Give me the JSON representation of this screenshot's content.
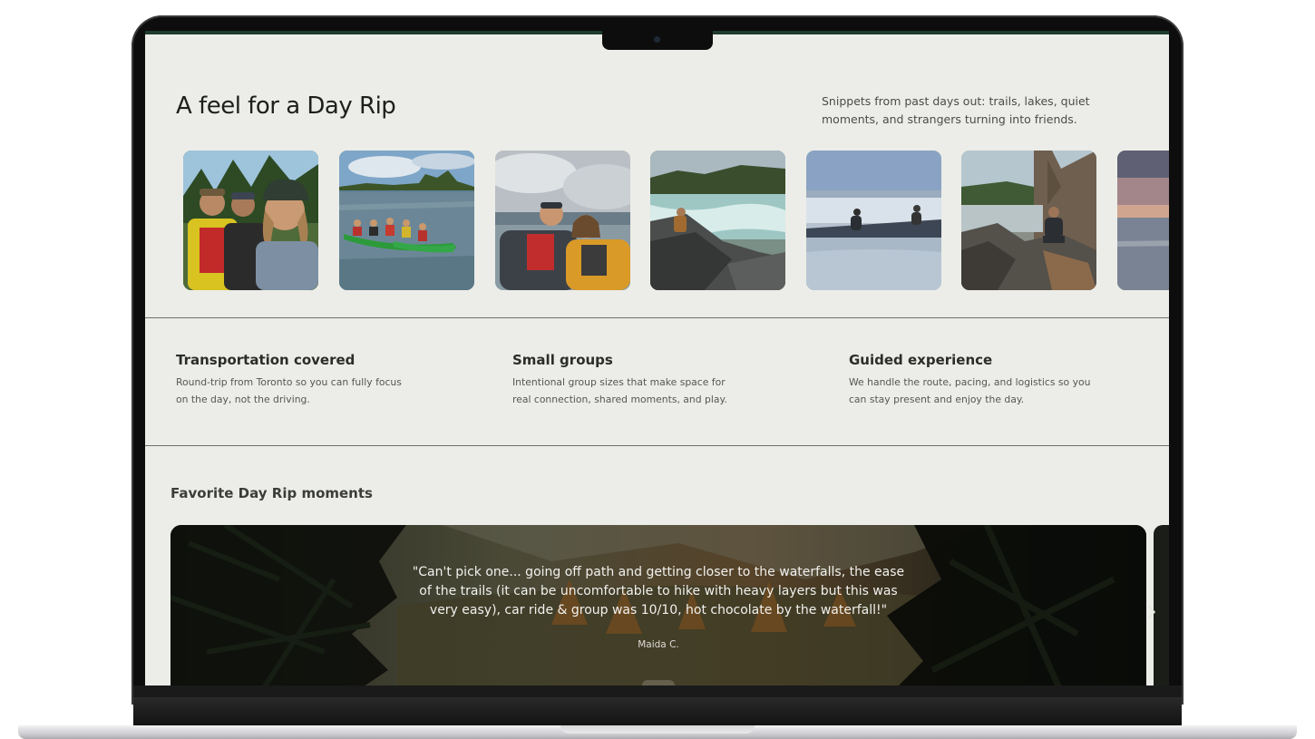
{
  "hero": {
    "title": "A feel for a Day Rip",
    "intro": "Snippets from past days out: trails, lakes, quiet moments, and strangers turning into friends."
  },
  "gallery": {
    "photos": [
      {
        "icon": "group-selfie-photo"
      },
      {
        "icon": "canoe-on-lake-photo"
      },
      {
        "icon": "paddlers-selfie-photo"
      },
      {
        "icon": "waterfall-rocks-photo"
      },
      {
        "icon": "frozen-lake-photo"
      },
      {
        "icon": "rocky-shore-photo"
      },
      {
        "icon": "sunset-lake-photo"
      }
    ]
  },
  "features": [
    {
      "title": "Transportation covered",
      "desc": "Round-trip from Toronto so you can fully focus on the day, not the driving."
    },
    {
      "title": "Small groups",
      "desc": "Intentional group sizes that make space for real connection, shared moments, and play."
    },
    {
      "title": "Guided experience",
      "desc": "We handle the route, pacing, and logistics so you can stay present and enjoy the day."
    }
  ],
  "moments": {
    "title": "Favorite Day Rip moments",
    "quote": "\"Can't pick one... going off path and getting closer to the waterfalls, the ease of the trails (it can be uncomfortable to hike with heavy layers but this was very easy), car ride & group was 10/10, hot chocolate by the waterfall!\"",
    "author": "Maida C.",
    "next_icon": "chevron-right-icon"
  },
  "colors": {
    "screen_bg": "#ecede8",
    "accent": "#1e3b2c",
    "text_dark": "#1d1f1c"
  }
}
